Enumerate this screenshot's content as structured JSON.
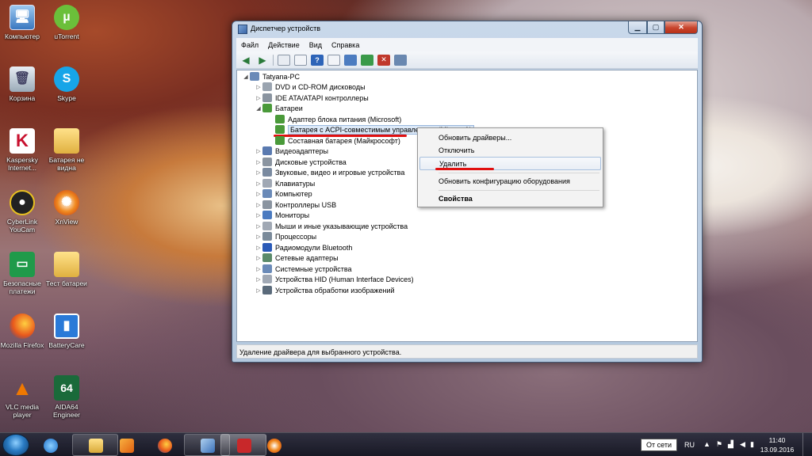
{
  "desktop": {
    "icons": [
      {
        "label": "Компьютер",
        "icon": "computer-icon"
      },
      {
        "label": "uTorrent",
        "icon": "utorrent-icon"
      },
      {
        "label": "Корзина",
        "icon": "recycle-bin-icon"
      },
      {
        "label": "Skype",
        "icon": "skype-icon"
      },
      {
        "label": "Kaspersky Internet...",
        "icon": "kaspersky-icon"
      },
      {
        "label": "Батарея не видна",
        "icon": "folder-icon"
      },
      {
        "label": "CyberLink YouCam",
        "icon": "youcam-icon"
      },
      {
        "label": "XnView",
        "icon": "xnview-icon"
      },
      {
        "label": "Безопасные платежи",
        "icon": "safe-money-icon"
      },
      {
        "label": "Тест батареи",
        "icon": "folder-icon"
      },
      {
        "label": "Mozilla Firefox",
        "icon": "firefox-icon"
      },
      {
        "label": "BatteryCare",
        "icon": "batterycare-icon"
      },
      {
        "label": "VLC media player",
        "icon": "vlc-icon"
      },
      {
        "label": "AIDA64 Engineer",
        "icon": "aida64-icon"
      }
    ]
  },
  "window": {
    "title": "Диспетчер устройств",
    "menu": [
      "Файл",
      "Действие",
      "Вид",
      "Справка"
    ],
    "tree": {
      "root": "Tatyana-PC",
      "items": [
        "DVD и CD-ROM дисководы",
        "IDE ATA/ATAPI контроллеры",
        "Батареи",
        "Адаптер блока питания (Microsoft)",
        "Батарея с ACPI-совместимым управлением (Microsoft)",
        "Составная батарея (Майкрософт)",
        "Видеоадаптеры",
        "Дисковые устройства",
        "Звуковые, видео и игровые устройства",
        "Клавиатуры",
        "Компьютер",
        "Контроллеры USB",
        "Мониторы",
        "Мыши и иные указывающие устройства",
        "Процессоры",
        "Радиомодули Bluetooth",
        "Сетевые адаптеры",
        "Системные устройства",
        "Устройства HID (Human Interface Devices)",
        "Устройства обработки изображений"
      ]
    },
    "status_text": "Удаление драйвера для выбранного устройства."
  },
  "context_menu": {
    "items": [
      "Обновить драйверы...",
      "Отключить",
      "Удалить",
      "Обновить конфигурацию оборудования",
      "Свойства"
    ]
  },
  "taskbar": {
    "tray_tooltip": "От сети",
    "language": "RU",
    "time": "11:40",
    "date": "13.09.2016"
  },
  "colors": {
    "highlight_red": "#e01010",
    "selection_blue": "#dce9f8"
  }
}
